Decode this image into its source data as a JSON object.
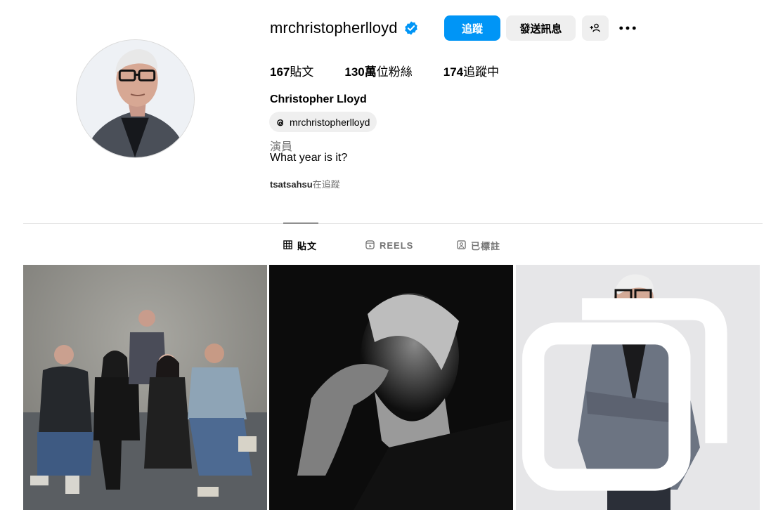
{
  "profile": {
    "username": "mrchristopherlloyd",
    "verified": true,
    "full_name": "Christopher Lloyd",
    "threads_handle": "mrchristopherlloyd",
    "bio_category": "演員",
    "bio_text": "What year is it?",
    "followed_by_user": "tsatsahsu",
    "followed_by_suffix": "在追蹤"
  },
  "actions": {
    "follow_label": "追蹤",
    "message_label": "發送訊息",
    "add_user_icon": "add-user-icon",
    "more_icon": "more-horizontal-icon"
  },
  "stats": {
    "posts_count": "167",
    "posts_label": "貼文",
    "followers_count": "130萬",
    "followers_label": "位粉絲",
    "following_count": "174",
    "following_label": "追蹤中"
  },
  "tabs": [
    {
      "label": "貼文",
      "icon": "grid-icon",
      "active": true
    },
    {
      "label": "REELS",
      "icon": "reels-icon",
      "active": false
    },
    {
      "label": "已標註",
      "icon": "tagged-icon",
      "active": false
    }
  ],
  "colors": {
    "accent": "#0095f6",
    "button_secondary": "#efefef",
    "muted_text": "#737373",
    "divider": "#dbdbdb"
  },
  "posts": [
    {
      "name": "group-photo",
      "multi": false
    },
    {
      "name": "bw-portrait",
      "multi": false
    },
    {
      "name": "standing-portrait",
      "multi": true
    }
  ]
}
